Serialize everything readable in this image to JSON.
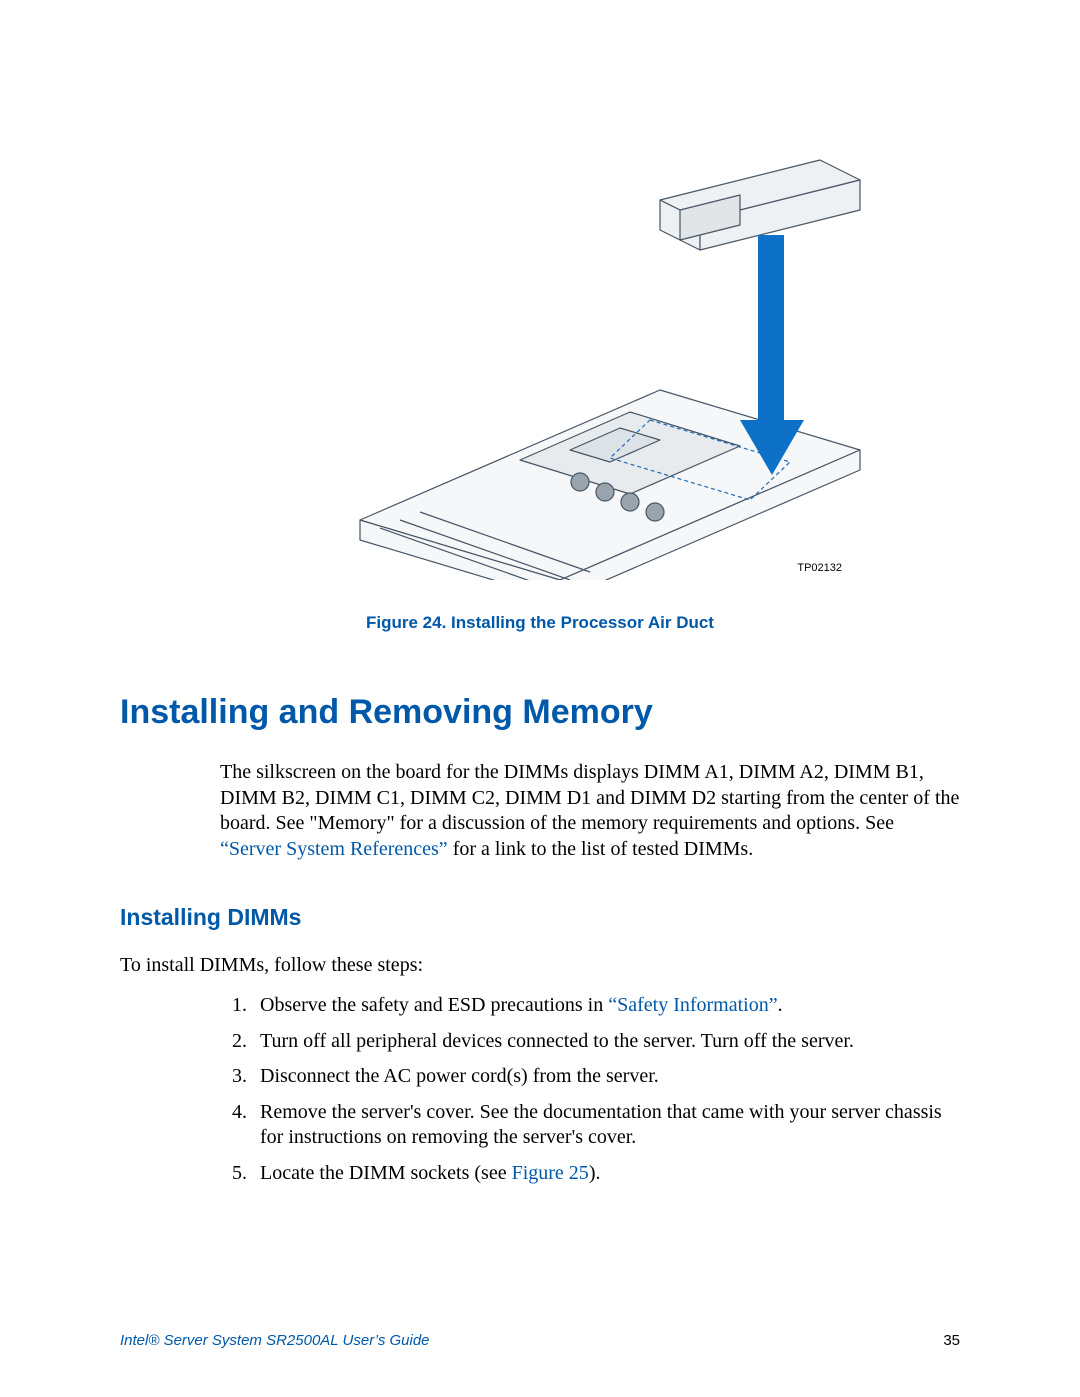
{
  "figure": {
    "image_id": "TP02132",
    "caption": "Figure 24. Installing the Processor Air Duct"
  },
  "headings": {
    "main": "Installing and Removing Memory",
    "sub": "Installing DIMMs"
  },
  "intro": {
    "part1": "The silkscreen on the board for the DIMMs displays DIMM A1, DIMM A2, DIMM B1, DIMM B2, DIMM C1, DIMM C2, DIMM D1 and DIMM D2 starting from the center of the board. See \"Memory\" for a discussion of the memory requirements and options. See ",
    "link": "“Server System References”",
    "part2": " for a link to the list of tested DIMMs."
  },
  "steps_intro": "To install DIMMs, follow these steps:",
  "steps": {
    "s1a": "Observe the safety and ESD precautions in ",
    "s1link": "“Safety Information”",
    "s1b": ".",
    "s2": "Turn off all peripheral devices connected to the server. Turn off the server.",
    "s3": "Disconnect the AC power cord(s) from the server.",
    "s4": "Remove the server's cover. See the documentation that came with your server chassis for instructions on removing the server's cover.",
    "s5a": "Locate the DIMM sockets (see ",
    "s5link": "Figure 25",
    "s5b": ")."
  },
  "footer": {
    "title": "Intel® Server System SR2500AL User’s Guide",
    "page": "35"
  }
}
